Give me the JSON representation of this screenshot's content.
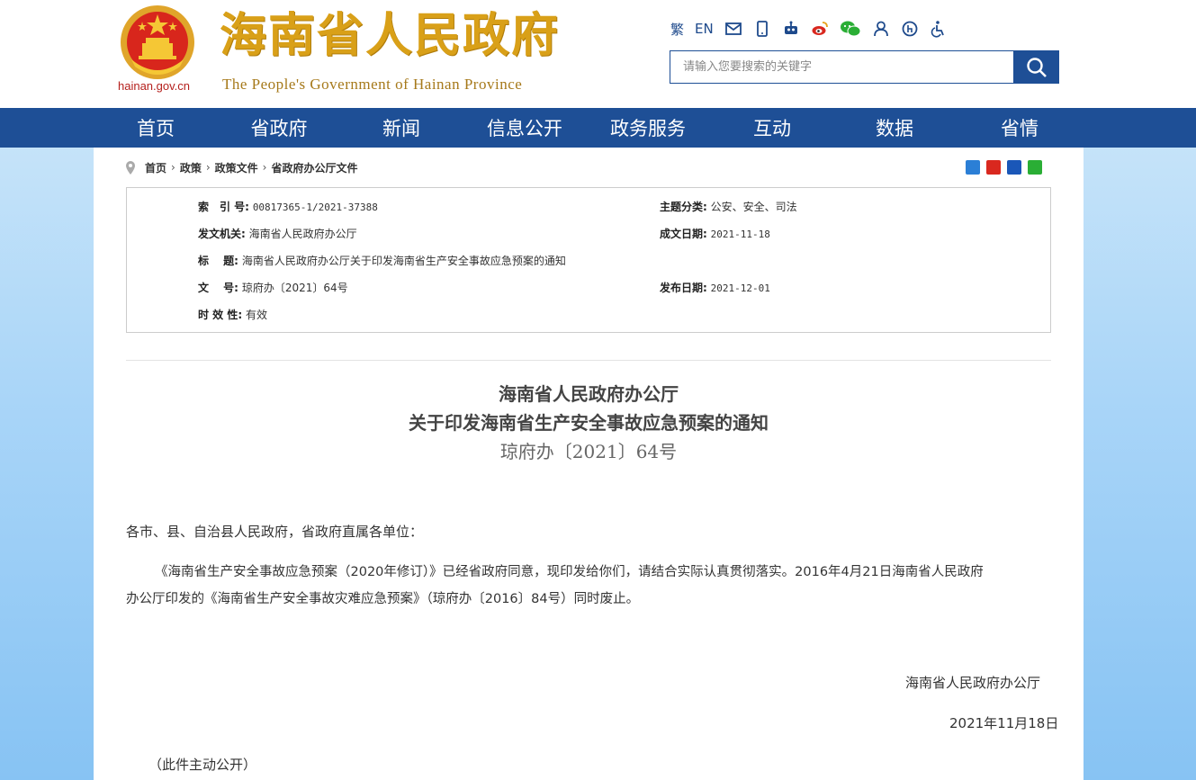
{
  "header": {
    "domain": "hainan.gov.cn",
    "title_cn": "海南省人民政府",
    "title_en": "The People's Government  of Hainan Province",
    "tools": {
      "traditional": "繁",
      "english": "EN"
    },
    "search_placeholder": "请输入您要搜索的关键字",
    "icons": [
      "mail-icon",
      "mobile-icon",
      "robot-icon",
      "weibo-icon",
      "wechat-icon",
      "user-icon",
      "elderly-icon",
      "accessibility-icon",
      "search-icon"
    ]
  },
  "nav": {
    "items": [
      "首页",
      "省政府",
      "新闻",
      "信息公开",
      "政务服务",
      "互动",
      "数据",
      "省情"
    ]
  },
  "breadcrumb": {
    "items": [
      "首页",
      "政策",
      "政策文件",
      "省政府办公厅文件"
    ]
  },
  "info": {
    "index_label": "索　引 号:",
    "index_value": "00817365-1/2021-37388",
    "subject_label": "主题分类:",
    "subject_value": "公安、安全、司法",
    "issuer_label": "发文机关:",
    "issuer_value": "海南省人民政府办公厅",
    "created_label": "成文日期:",
    "created_value": "2021-11-18",
    "title_label": "标　 题:",
    "title_value": "海南省人民政府办公厅关于印发海南省生产安全事故应急预案的通知",
    "docno_label": "文　 号:",
    "docno_value": "琼府办〔2021〕64号",
    "published_label": "发布日期:",
    "published_value": "2021-12-01",
    "validity_label": "时 效 性:",
    "validity_value": "有效"
  },
  "article": {
    "title_line1": "海南省人民政府办公厅",
    "title_line2": "关于印发海南省生产安全事故应急预案的通知",
    "doc_number": "琼府办〔2021〕64号",
    "salutation": "各市、县、自治县人民政府，省政府直属各单位：",
    "body_line1": "《海南省生产安全事故应急预案（2020年修订）》已经省政府同意，现印发给你们，请结合实际认真贯彻落实。2016年4月21日海南省人民政府",
    "body_line2": "办公厅印发的《海南省生产安全事故灾难应急预案》（琼府办〔2016〕84号）同时废止。",
    "signature": "海南省人民政府办公厅",
    "date": "2021年11月18日",
    "note": "（此件主动公开）"
  },
  "colors": {
    "nav_bg": "#1e4f96",
    "title_gold": "#d9a018",
    "side_blue": "#a9d5f8"
  }
}
